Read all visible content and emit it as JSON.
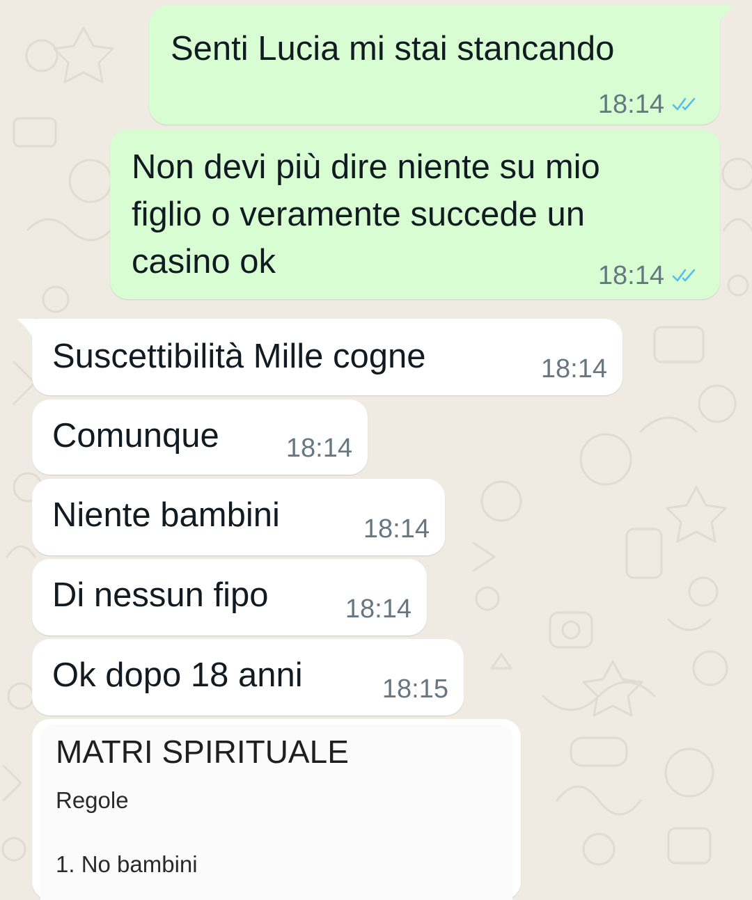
{
  "chat": {
    "outgoing": [
      {
        "text": "Senti Lucia mi stai stancando",
        "time": "18:14",
        "status_icon": "double-check-read-icon"
      },
      {
        "text": "Non devi più dire niente su mio\nfiglio o veramente succede un\ncasino ok",
        "time": "18:14",
        "status_icon": "double-check-read-icon"
      }
    ],
    "incoming": [
      {
        "text": "Suscettibilità Mille cogne",
        "time": "18:14"
      },
      {
        "text": "Comunque",
        "time": "18:14"
      },
      {
        "text": "Niente bambini",
        "time": "18:14"
      },
      {
        "text": "Di nessun fipo",
        "time": "18:14"
      },
      {
        "text": "Ok dopo 18 anni",
        "time": "18:15"
      }
    ],
    "shared_document": {
      "title": "MATRI SPIRITUALE",
      "lines": [
        "Regole",
        "1. No bambini"
      ]
    }
  },
  "colors": {
    "chat_background": "#efeae2",
    "outgoing_bubble": "#d9fdd3",
    "incoming_bubble": "#ffffff",
    "read_tick": "#53bdeb",
    "timestamp": "#667781"
  }
}
